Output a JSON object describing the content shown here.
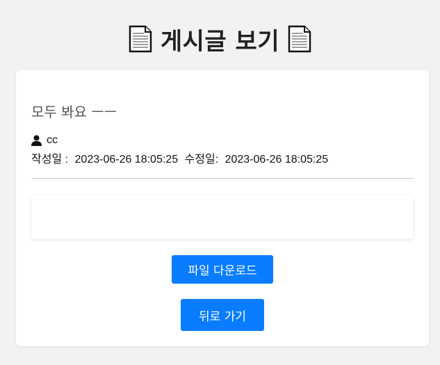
{
  "header": {
    "title": "게시글 보기",
    "left_icon": "document-icon",
    "right_icon": "document-icon"
  },
  "post": {
    "title": "모두 봐요 ㅡㅡ",
    "author_icon": "user-icon",
    "author": "cc",
    "created_label": "작성일 :",
    "created_at": "2023-06-26 18:05:25",
    "updated_label": "수정일:",
    "updated_at": "2023-06-26 18:05:25",
    "content": ""
  },
  "actions": {
    "download_label": "파일 다운로드",
    "back_label": "뒤로 가기"
  },
  "colors": {
    "background": "#f2f2f2",
    "card": "#ffffff",
    "primary_button": "#0a7cff"
  }
}
